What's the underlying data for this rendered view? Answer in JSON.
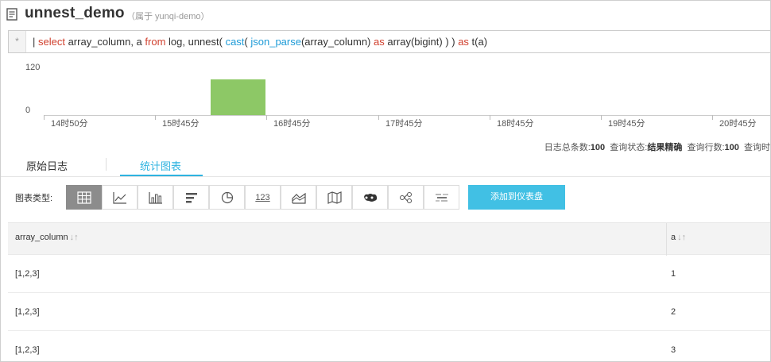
{
  "header": {
    "title": "unnest_demo",
    "project_tag": "（属于 yunqi-demo）"
  },
  "query": {
    "gutter": "*",
    "tokens": [
      {
        "t": "| ",
        "c": "plain"
      },
      {
        "t": "select",
        "c": "kw"
      },
      {
        "t": "  array_column, a   ",
        "c": "plain"
      },
      {
        "t": "from",
        "c": "kw"
      },
      {
        "t": " log, unnest( ",
        "c": "plain"
      },
      {
        "t": "cast",
        "c": "fn"
      },
      {
        "t": "( ",
        "c": "plain"
      },
      {
        "t": "json_parse",
        "c": "fn"
      },
      {
        "t": "(array_column)   ",
        "c": "plain"
      },
      {
        "t": "as",
        "c": "kw"
      },
      {
        "t": " array(bigint) ) ) ",
        "c": "plain"
      },
      {
        "t": "as",
        "c": "kw"
      },
      {
        "t": "  t(a)",
        "c": "plain"
      }
    ]
  },
  "histogram": {
    "y_ticks": [
      "120",
      "0"
    ],
    "x_ticks": [
      "14时50分",
      "15时45分",
      "16时45分",
      "17时45分",
      "18时45分",
      "19时45分",
      "20时45分"
    ],
    "bar_color": "#8dc866",
    "bar_value": 100,
    "y_max": 120
  },
  "stats": {
    "total_label": "日志总条数:",
    "total_value": "100",
    "status_label": "查询状态:",
    "status_value": "结果精确",
    "rows_label": "查询行数:",
    "rows_value": "100",
    "time_label": "查询时"
  },
  "tabs": {
    "raw_logs": "原始日志",
    "stats_chart": "统计图表"
  },
  "chart_types": {
    "label": "图表类型:",
    "icons": [
      "table-icon",
      "line-chart-icon",
      "bar-chart-icon",
      "horizontal-bar-icon",
      "pie-chart-icon",
      "number-icon",
      "area-chart-icon",
      "map-icon",
      "china-map-icon",
      "flow-icon",
      "word-cloud-icon"
    ],
    "number_glyph": "123",
    "add_dashboard": "添加到仪表盘"
  },
  "table": {
    "columns": [
      "array_column",
      "a"
    ],
    "sort_glyph": "↓↑",
    "rows": [
      [
        "[1,2,3]",
        "1"
      ],
      [
        "[1,2,3]",
        "2"
      ],
      [
        "[1,2,3]",
        "3"
      ]
    ]
  }
}
